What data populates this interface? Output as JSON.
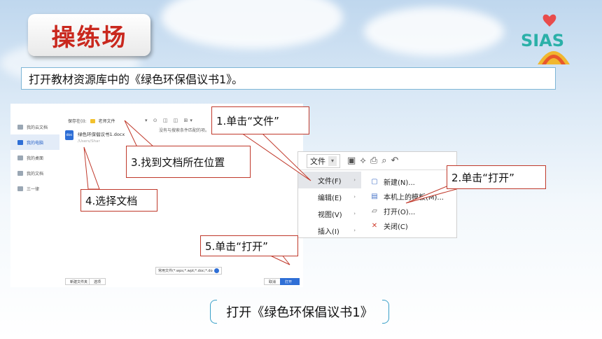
{
  "header": {
    "title": "操练场"
  },
  "logo": {
    "text": "SIAS"
  },
  "instruction": "打开教材资源库中的《绿色环保倡议书1》。",
  "file_dialog": {
    "sidebar": [
      "我的云文档",
      "我的电脑",
      "我的桌面",
      "我的文档",
      "三一律"
    ],
    "active_sidebar_index": 1,
    "path_label": "保存在(I):",
    "path_value": "老师文件",
    "empty_msg": "没有与搜索条件匹配的项。",
    "file_icon": "doc",
    "file_name": "绿色环保倡议书1.docx",
    "file_location": "/Users/Shar",
    "file_types": "常用文件(*.wps;*.wpt;*.doc;*.do",
    "buttons": {
      "new_folder": "新建文件夹",
      "select": "选项",
      "cancel": "取消",
      "open": "打开"
    }
  },
  "wps_menu": {
    "file_button": "文件",
    "left_items": [
      {
        "label": "文件(F)",
        "active": true
      },
      {
        "label": "编辑(E)",
        "active": false
      },
      {
        "label": "视图(V)",
        "active": false
      },
      {
        "label": "插入(I)",
        "active": false
      }
    ],
    "right_items": [
      {
        "label": "新建(N)...",
        "icon": "new-doc-icon"
      },
      {
        "label": "本机上的模板(M)...",
        "icon": "template-icon"
      },
      {
        "label": "打开(O)...",
        "icon": "folder-open-icon"
      },
      {
        "label": "关闭(C)",
        "icon": "close-doc-icon"
      }
    ]
  },
  "callouts": {
    "step1": "1.单击“文件”",
    "step2": "2.单击“打开”",
    "step3": "3.找到文档所在位置",
    "step4": "4.选择文档",
    "step5": "5.单击“打开”"
  },
  "caption": "打开《绿色环保倡议书1》",
  "colors": {
    "title_red": "#c9281e",
    "callout_border": "#c0392b",
    "accent_blue": "#2f6fd6"
  }
}
